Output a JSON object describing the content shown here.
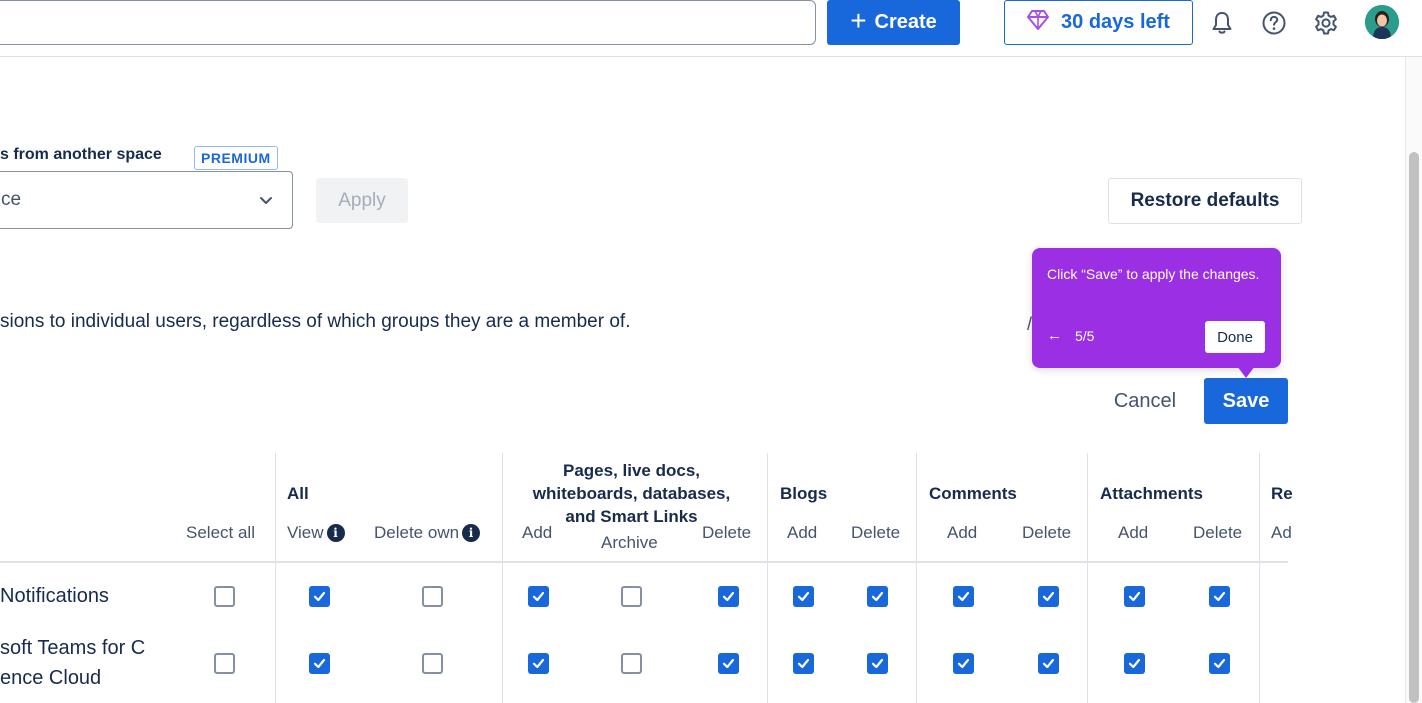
{
  "topbar": {
    "create_label": "Create",
    "trial_label": "30 days left",
    "icons": [
      "plus-icon",
      "diamond-icon",
      "bell-icon",
      "help-icon",
      "gear-icon",
      "avatar"
    ]
  },
  "copy": {
    "label": "s from another space",
    "badge": "PREMIUM",
    "select_value": "ce",
    "apply_label": "Apply"
  },
  "restore_label": "Restore defaults",
  "description": "sions to individual users, regardless of which groups they are a member of.",
  "tooltip": {
    "text": "Click “Save” to apply the changes.",
    "back": "←",
    "step": "5/5",
    "done_label": "Done"
  },
  "actions": {
    "cancel_label": "Cancel",
    "save_label": "Save"
  },
  "table": {
    "groups": {
      "all": "All",
      "pages": [
        "Pages, live docs,",
        "whiteboards, databases,",
        "and Smart Links"
      ],
      "blogs": "Blogs",
      "comments": "Comments",
      "attachments": "Attachments",
      "restrictions": "Re"
    },
    "columns": {
      "select_all": "Select all",
      "view": "View",
      "delete_own": "Delete own",
      "pages_add": "Add",
      "pages_archive": "Archive",
      "pages_delete": "Delete",
      "blogs_add": "Add",
      "blogs_delete": "Delete",
      "comments_add": "Add",
      "comments_delete": "Delete",
      "attachments_add": "Add",
      "attachments_delete": "Delete",
      "restrictions_add": "Ad"
    },
    "rows": [
      {
        "name_line1": "Notifications",
        "name_line2": "",
        "checks": [
          false,
          true,
          false,
          true,
          false,
          true,
          true,
          true,
          true,
          true,
          true,
          true
        ]
      },
      {
        "name_line1": "soft Teams for C",
        "name_line2": "ence Cloud",
        "checks": [
          false,
          true,
          false,
          true,
          false,
          true,
          true,
          true,
          true,
          true,
          true,
          true
        ]
      }
    ]
  },
  "colors": {
    "primary": "#1868db",
    "tooltip": "#9a2fe3",
    "premium": "#1868db"
  }
}
